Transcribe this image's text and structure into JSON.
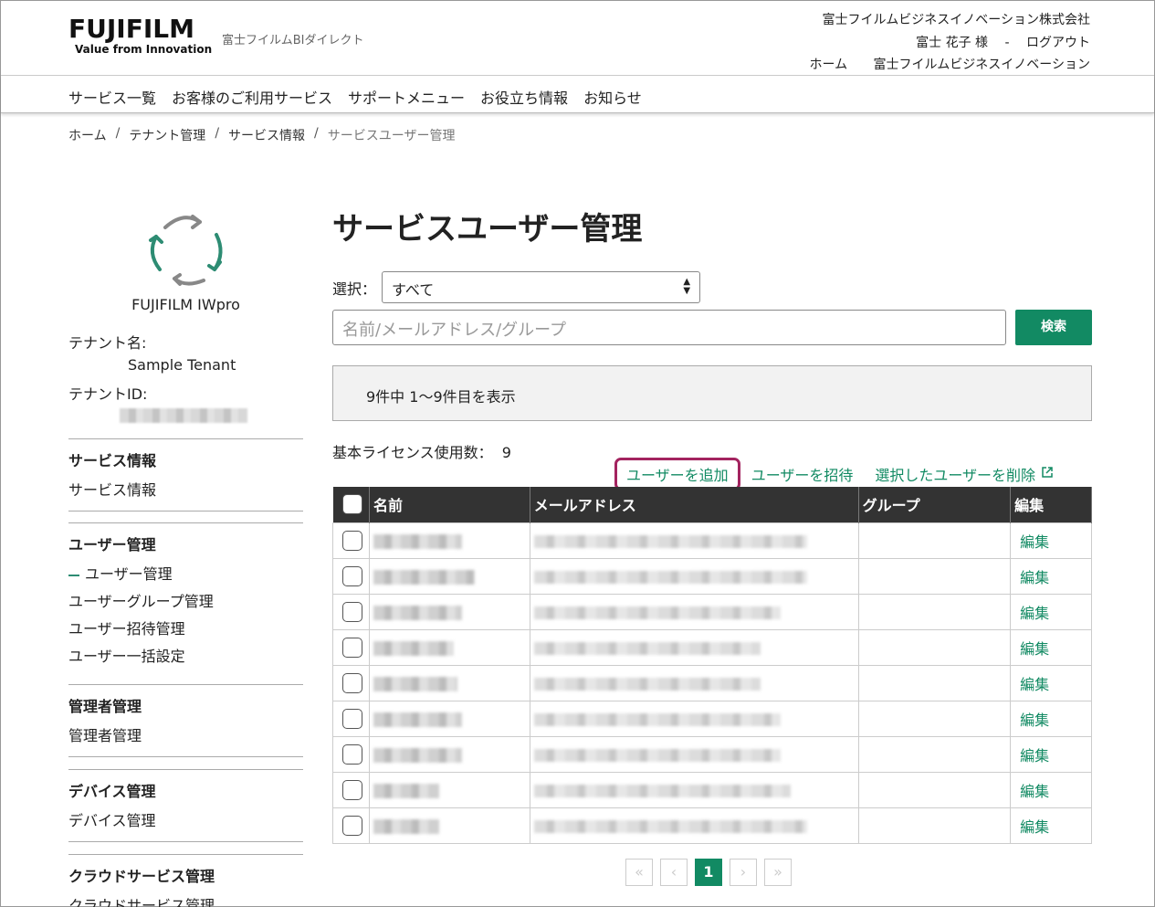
{
  "header": {
    "logo_main": "FUJIFILM",
    "logo_sub": "Value from Innovation",
    "brand_text": "富士フイルムBIダイレクト",
    "company": "富士フイルムビジネスイノベーション株式会社",
    "user_name": "富士 花子 様",
    "user_sep": "-",
    "logout": "ログアウト",
    "links": [
      "ホーム",
      "富士フイルムビジネスイノベーション"
    ]
  },
  "nav": {
    "items": [
      "サービス一覧",
      "お客様のご利用サービス",
      "サポートメニュー",
      "お役立ち情報",
      "お知らせ"
    ]
  },
  "breadcrumb": {
    "items": [
      "ホーム",
      "テナント管理",
      "サービス情報",
      "サービスユーザー管理"
    ]
  },
  "sidebar": {
    "service_name": "FUJIFILM IWpro",
    "tenant_label": "テナント名:",
    "tenant_name": "Sample Tenant",
    "tenant_id_label": "テナントID:",
    "sections": [
      {
        "title": "サービス情報",
        "items": [
          "サービス情報"
        ]
      },
      {
        "title": "ユーザー管理",
        "items": [
          "ユーザー管理",
          "ユーザーグループ管理",
          "ユーザー招待管理",
          "ユーザー一括設定"
        ]
      },
      {
        "title": "管理者管理",
        "items": [
          "管理者管理"
        ]
      },
      {
        "title": "デバイス管理",
        "items": [
          "デバイス管理"
        ]
      },
      {
        "title": "クラウドサービス管理",
        "items": [
          "クラウドサービス管理"
        ]
      }
    ]
  },
  "main": {
    "title": "サービスユーザー管理",
    "select_label": "選択：",
    "select_value": "すべて",
    "search_placeholder": "名前/メールアドレス/グループ",
    "search_button": "検索",
    "result_text": "9件中 1〜9件目を表示",
    "license_label": "基本ライセンス使用数：",
    "license_count": "9",
    "add_user": "ユーザーを追加",
    "invite_user": "ユーザーを招待",
    "delete_user": "選択したユーザーを削除"
  },
  "table": {
    "columns": [
      "名前",
      "メールアドレス",
      "グループ",
      "編集"
    ],
    "rows": [
      {
        "edit": "編集",
        "name_blur": 0.55,
        "mail_blur": 0.83
      },
      {
        "edit": "編集",
        "name_blur": 0.63,
        "mail_blur": 0.83
      },
      {
        "edit": "編集",
        "name_blur": 0.55,
        "mail_blur": 0.75
      },
      {
        "edit": "編集",
        "name_blur": 0.5,
        "mail_blur": 0.69
      },
      {
        "edit": "編集",
        "name_blur": 0.52,
        "mail_blur": 0.69
      },
      {
        "edit": "編集",
        "name_blur": 0.55,
        "mail_blur": 0.75
      },
      {
        "edit": "編集",
        "name_blur": 0.55,
        "mail_blur": 0.75
      },
      {
        "edit": "編集",
        "name_blur": 0.41,
        "mail_blur": 0.78
      },
      {
        "edit": "編集",
        "name_blur": 0.41,
        "mail_blur": 0.83
      }
    ]
  },
  "pagination": {
    "first": "«",
    "prev": "‹",
    "current": "1",
    "next": "›",
    "last": "»"
  },
  "colors": {
    "accent": "#128a63",
    "highlight_border": "#a3235f",
    "table_header": "#333333"
  }
}
